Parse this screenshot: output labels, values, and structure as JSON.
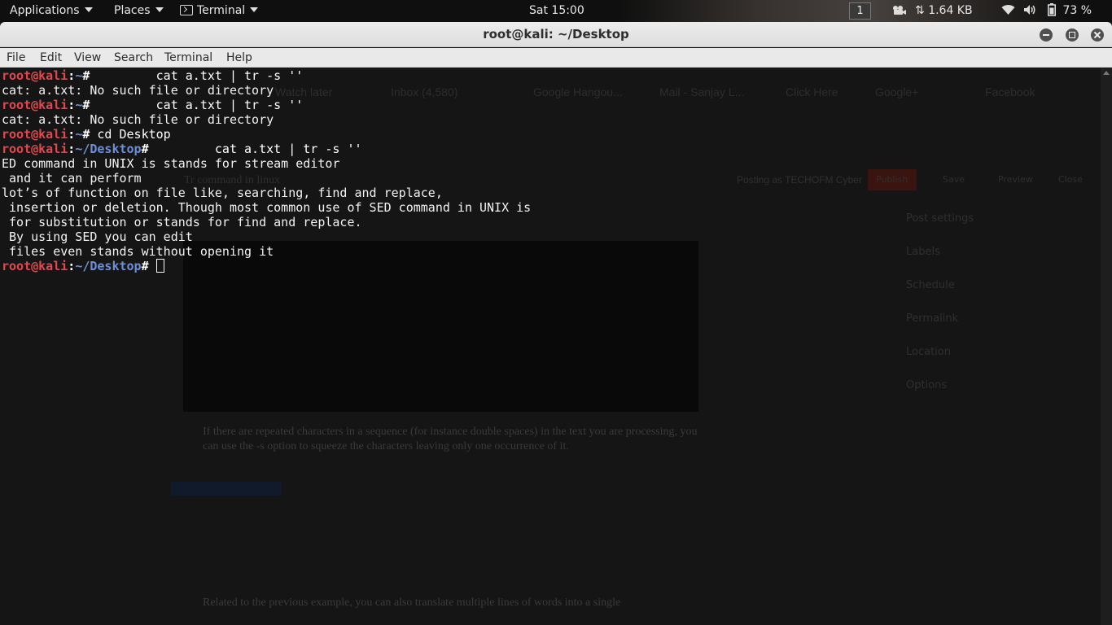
{
  "panel": {
    "applications": "Applications",
    "places": "Places",
    "terminal": "Terminal",
    "clock": "Sat 15:00",
    "workspace": "1",
    "network_speed": "1.64 KB",
    "battery": "73 %"
  },
  "window": {
    "title": "root@kali: ~/Desktop"
  },
  "menu": {
    "file": "File",
    "edit": "Edit",
    "view": "View",
    "search": "Search",
    "terminal": "Terminal",
    "help": "Help"
  },
  "terminal": {
    "lines": [
      {
        "user": "root@kali",
        "sep": ":",
        "path": "~",
        "symbol": "#",
        "cmd": "         cat a.txt | tr -s ''"
      },
      {
        "text": "cat: a.txt: No such file or directory"
      },
      {
        "user": "root@kali",
        "sep": ":",
        "path": "~",
        "symbol": "#",
        "cmd": "         cat a.txt | tr -s ''"
      },
      {
        "text": "cat: a.txt: No such file or directory"
      },
      {
        "user": "root@kali",
        "sep": ":",
        "path": "~",
        "symbol": "#",
        "cmd": " cd Desktop"
      },
      {
        "user": "root@kali",
        "sep": ":",
        "path": "~/Desktop",
        "symbol": "#",
        "cmd": "         cat a.txt | tr -s ''"
      },
      {
        "text": "ED command in UNIX is stands for stream editor"
      },
      {
        "text": " and it can perform"
      },
      {
        "text": "lot’s of function on file like, searching, find and replace,"
      },
      {
        "text": " insertion or deletion. Though most common use of SED command in UNIX is"
      },
      {
        "text": " for substitution or stands for find and replace."
      },
      {
        "text": " By using SED you can edit"
      },
      {
        "text": " files even stands without opening it"
      },
      {
        "user": "root@kali",
        "sep": ":",
        "path": "~/Desktop",
        "symbol": "#",
        "cmd": " ",
        "cursor": true
      }
    ]
  },
  "background": {
    "tabs": [
      "Watch later",
      "Inbox (4,580)",
      "Google Hangou...",
      "Mail - Sanjay L...",
      "Click Here",
      "Google+",
      "Facebook"
    ],
    "post_title": "Tr command in linux",
    "posting_as": "Posting as TECHOFM Cyber",
    "buttons": [
      "Publish",
      "Save",
      "Preview",
      "Close"
    ],
    "sidebar": [
      "Post settings",
      "Labels",
      "Schedule",
      "Permalink",
      "Location",
      "Options"
    ],
    "paragraph1": "If there are repeated characters in a sequence (for instance double spaces) in the text you are processing, you can use the -s option to squeeze the characters leaving only one occurrence of it.",
    "paragraph2": "Related to the previous example, you can also translate multiple lines of words into a single"
  }
}
